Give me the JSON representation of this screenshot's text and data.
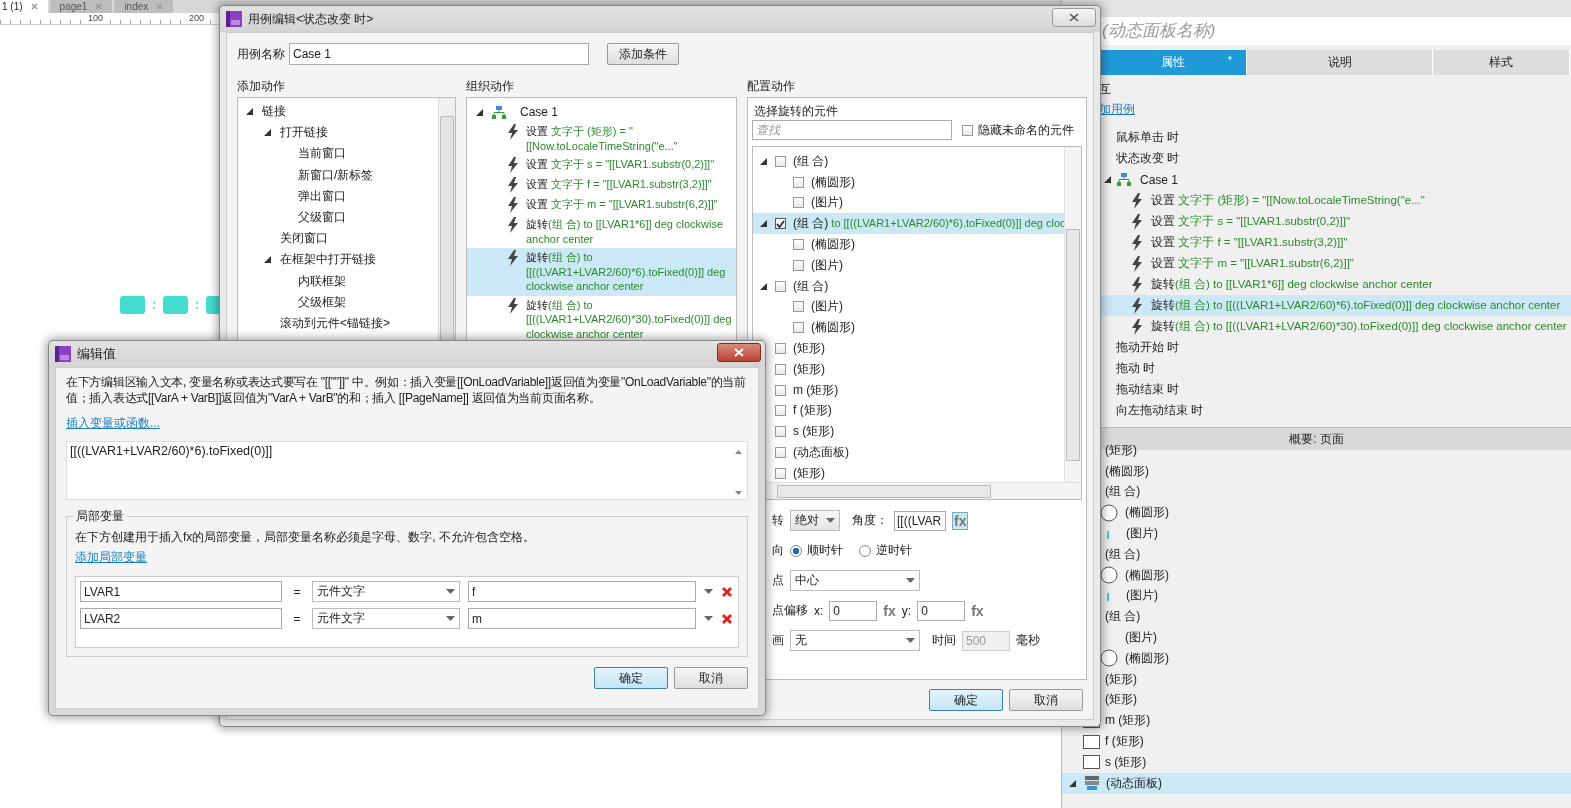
{
  "app_tabs": [
    {
      "label": "1 (1)",
      "selected": true
    },
    {
      "label": "page1",
      "selected": false
    },
    {
      "label": "index",
      "selected": false
    }
  ],
  "ruler": {
    "marks": [
      "100",
      "200"
    ]
  },
  "canvas": {
    "separators": [
      ":",
      ":"
    ]
  },
  "inspector": {
    "name_placeholder": "(动态面板名称)",
    "tabs": [
      {
        "label": "属性",
        "selected": true,
        "marker": "*"
      },
      {
        "label": "说明",
        "selected": false
      },
      {
        "label": "样式",
        "selected": false
      }
    ],
    "section_title": "互",
    "add_case_link": "加用例",
    "events": [
      {
        "label": "鼠标单击 时"
      },
      {
        "label": "状态改变 时",
        "cases": [
          {
            "name": "Case 1",
            "expanded": true,
            "actions": [
              {
                "verb": "设置 ",
                "detail": "文字于 (矩形) = \"[[Now.toLocaleTimeString(\"e...\"",
                "selected": false
              },
              {
                "verb": "设置 ",
                "detail": "文字于 s = \"[[LVAR1.substr(0,2)]]\"",
                "selected": false
              },
              {
                "verb": "设置 ",
                "detail": "文字于 f = \"[[LVAR1.substr(3,2)]]\"",
                "selected": false
              },
              {
                "verb": "设置 ",
                "detail": "文字于 m = \"[[LVAR1.substr(6,2)]]\"",
                "selected": false
              },
              {
                "verb": "旋转",
                "detail": "(组 合) to [[LVAR1*6]] deg clockwise anchor center",
                "selected": false
              },
              {
                "verb": "旋转",
                "detail": "(组 合) to [[((LVAR1+LVAR2/60)*6).toFixed(0)]] deg clockwise anchor center",
                "selected": true
              },
              {
                "verb": "旋转",
                "detail": "(组 合) to [[((LVAR1+LVAR2/60)*30).toFixed(0)]] deg clockwise anchor center",
                "selected": false
              }
            ]
          }
        ]
      },
      {
        "label": "拖动开始 时"
      },
      {
        "label": "拖动 时"
      },
      {
        "label": "拖动结束 时"
      },
      {
        "label": "向左拖动结束 时"
      }
    ]
  },
  "outline": {
    "title": "概要: 页面",
    "items": [
      {
        "label": "(矩形)",
        "kind": "plain",
        "selected": false
      },
      {
        "label": "(椭圆形)",
        "kind": "plain",
        "selected": false
      },
      {
        "label": "(组 合)",
        "kind": "plain",
        "selected": false
      },
      {
        "label": "(椭圆形)",
        "kind": "ellipse",
        "selected": false
      },
      {
        "label": "(图片)",
        "kind": "image",
        "selected": false
      },
      {
        "label": "(组 合)",
        "kind": "plain",
        "selected": false
      },
      {
        "label": "(椭圆形)",
        "kind": "ellipse",
        "selected": false
      },
      {
        "label": "(图片)",
        "kind": "image",
        "selected": false
      },
      {
        "label": "(组 合)",
        "kind": "plain",
        "selected": false
      },
      {
        "label": "(图片)",
        "kind": "indented",
        "selected": false
      },
      {
        "label": "(椭圆形)",
        "kind": "ellipse",
        "selected": false
      },
      {
        "label": "(矩形)",
        "kind": "plain",
        "selected": false
      },
      {
        "label": "(矩形)",
        "kind": "plain",
        "selected": false
      },
      {
        "label": "m (矩形)",
        "kind": "rect",
        "selected": false
      },
      {
        "label": "f (矩形)",
        "kind": "rect",
        "selected": false
      },
      {
        "label": "s (矩形)",
        "kind": "rect",
        "selected": false
      },
      {
        "label": "(动态面板)",
        "kind": "panel",
        "selected": true
      }
    ]
  },
  "case_editor": {
    "title": "用例编辑<状态改变 时>",
    "case_name_label": "用例名称",
    "case_name": "Case 1",
    "add_condition_button": "添加条件",
    "add_actions": {
      "title": "添加动作",
      "tree": [
        {
          "label": "链接",
          "expanded": true,
          "children": [
            {
              "label": "打开链接",
              "expanded": true,
              "children": [
                {
                  "label": "当前窗口"
                },
                {
                  "label": "新窗口/新标签"
                },
                {
                  "label": "弹出窗口"
                },
                {
                  "label": "父级窗口"
                }
              ]
            },
            {
              "label": "关闭窗口"
            },
            {
              "label": "在框架中打开链接",
              "expanded": true,
              "children": [
                {
                  "label": "内联框架"
                },
                {
                  "label": "父级框架"
                }
              ]
            },
            {
              "label": "滚动到元件<锚链接>"
            }
          ]
        }
      ]
    },
    "organize_actions": {
      "title": "组织动作",
      "case_name": "Case 1",
      "expanded": true,
      "actions": [
        {
          "verb": "设置 ",
          "detail": "文字于 (矩形) = \"[[Now.toLocaleTimeString(\"e...\"",
          "selected": false
        },
        {
          "verb": "设置 ",
          "detail": "文字于 s = \"[[LVAR1.substr(0,2)]]\"",
          "selected": false
        },
        {
          "verb": "设置 ",
          "detail": "文字于 f = \"[[LVAR1.substr(3,2)]]\"",
          "selected": false
        },
        {
          "verb": "设置 ",
          "detail": "文字于 m = \"[[LVAR1.substr(6,2)]]\"",
          "selected": false
        },
        {
          "verb": "旋转",
          "detail": "(组 合) to [[LVAR1*6]] deg clockwise anchor center",
          "selected": false
        },
        {
          "verb": "旋转",
          "detail": "(组 合) to [[((LVAR1+LVAR2/60)*6).toFixed(0)]] deg clockwise anchor center",
          "selected": true
        },
        {
          "verb": "旋转",
          "detail": "(组 合) to [[((LVAR1+LVAR2/60)*30).toFixed(0)]] deg clockwise anchor center",
          "selected": false
        }
      ]
    },
    "configure_actions": {
      "title": "配置动作",
      "panel_title": "选择旋转的元件",
      "search_placeholder": "查找",
      "hide_unnamed": {
        "label": "隐藏未命名的元件",
        "checked": false
      },
      "widgets": [
        {
          "label": "(组 合)",
          "checked": false,
          "selected": false,
          "expanded": true,
          "children": [
            {
              "label": "(椭圆形)",
              "checked": false,
              "selected": false
            },
            {
              "label": "(图片)",
              "checked": false,
              "selected": false
            }
          ]
        },
        {
          "label": "(组 合)",
          "target": "to [[((LVAR1+LVAR2/60)*6).toFixed(0)]] deg cloc",
          "checked": true,
          "selected": true,
          "expanded": true,
          "children": [
            {
              "label": "(椭圆形)",
              "checked": false,
              "selected": false
            },
            {
              "label": "(图片)",
              "checked": false,
              "selected": false
            }
          ]
        },
        {
          "label": "(组 合)",
          "checked": false,
          "selected": false,
          "expanded": true,
          "children": [
            {
              "label": "(图片)",
              "checked": false,
              "selected": false
            },
            {
              "label": "(椭圆形)",
              "checked": false,
              "selected": false
            }
          ]
        },
        {
          "label": "(矩形)",
          "checked": false,
          "selected": false
        },
        {
          "label": "(矩形)",
          "checked": false,
          "selected": false
        },
        {
          "label": "m (矩形)",
          "checked": false,
          "selected": false
        },
        {
          "label": "f (矩形)",
          "checked": false,
          "selected": false
        },
        {
          "label": "s (矩形)",
          "checked": false,
          "selected": false
        },
        {
          "label": "(动态面板)",
          "checked": false,
          "selected": false
        },
        {
          "label": "(矩形)",
          "checked": false,
          "selected": false
        }
      ],
      "rotate_label": "转",
      "rotate_mode": "绝对",
      "angle_label": "角度：",
      "angle_value": "[[((LVAR",
      "angle_fx": "fx",
      "direction_label": "向",
      "directions": [
        {
          "label": "顺时针",
          "selected": true
        },
        {
          "label": "逆时针",
          "selected": false
        }
      ],
      "anchor_label": "点",
      "anchor_value": "中心",
      "offset_label": "点偏移",
      "x_label": "x:",
      "x_value": "0",
      "x_fx": "fx",
      "y_label": "y:",
      "y_value": "0",
      "y_fx": "fx",
      "animation_label": "画",
      "animation_value": "无",
      "time_label": "时间",
      "time_value": "500",
      "time_disabled": true,
      "ms_label": "毫秒"
    },
    "buttons": [
      {
        "label": "确定",
        "default": true
      },
      {
        "label": "取消",
        "default": false
      }
    ]
  },
  "value_editor": {
    "title": "编辑值",
    "description": "在下方编辑区输入文本, 变量名称或表达式要写在 \"[[\"\"]]\" 中。例如：插入变量[[OnLoadVariable]]返回值为变量\"OnLoadVariable\"的当前值；插入表达式[[VarA + VarB]]返回值为\"VarA + VarB\"的和；插入 [[PageName]] 返回值为当前页面名称。",
    "insert_link": "插入变量或函数...",
    "value": "[[((LVAR1+LVAR2/60)*6).toFixed(0)]]",
    "local_vars": {
      "legend": "局部变量",
      "description": "在下方创建用于插入fx的局部变量，局部变量名称必须是字母、数字, 不允许包含空格。",
      "add_link": "添加局部变量",
      "rows": [
        {
          "name": "LVAR1",
          "equals": "=",
          "type": "元件文字",
          "target": "f"
        },
        {
          "name": "LVAR2",
          "equals": "=",
          "type": "元件文字",
          "target": "m"
        }
      ]
    },
    "buttons": [
      {
        "label": "确定",
        "default": true
      },
      {
        "label": "取消",
        "default": false
      }
    ]
  }
}
